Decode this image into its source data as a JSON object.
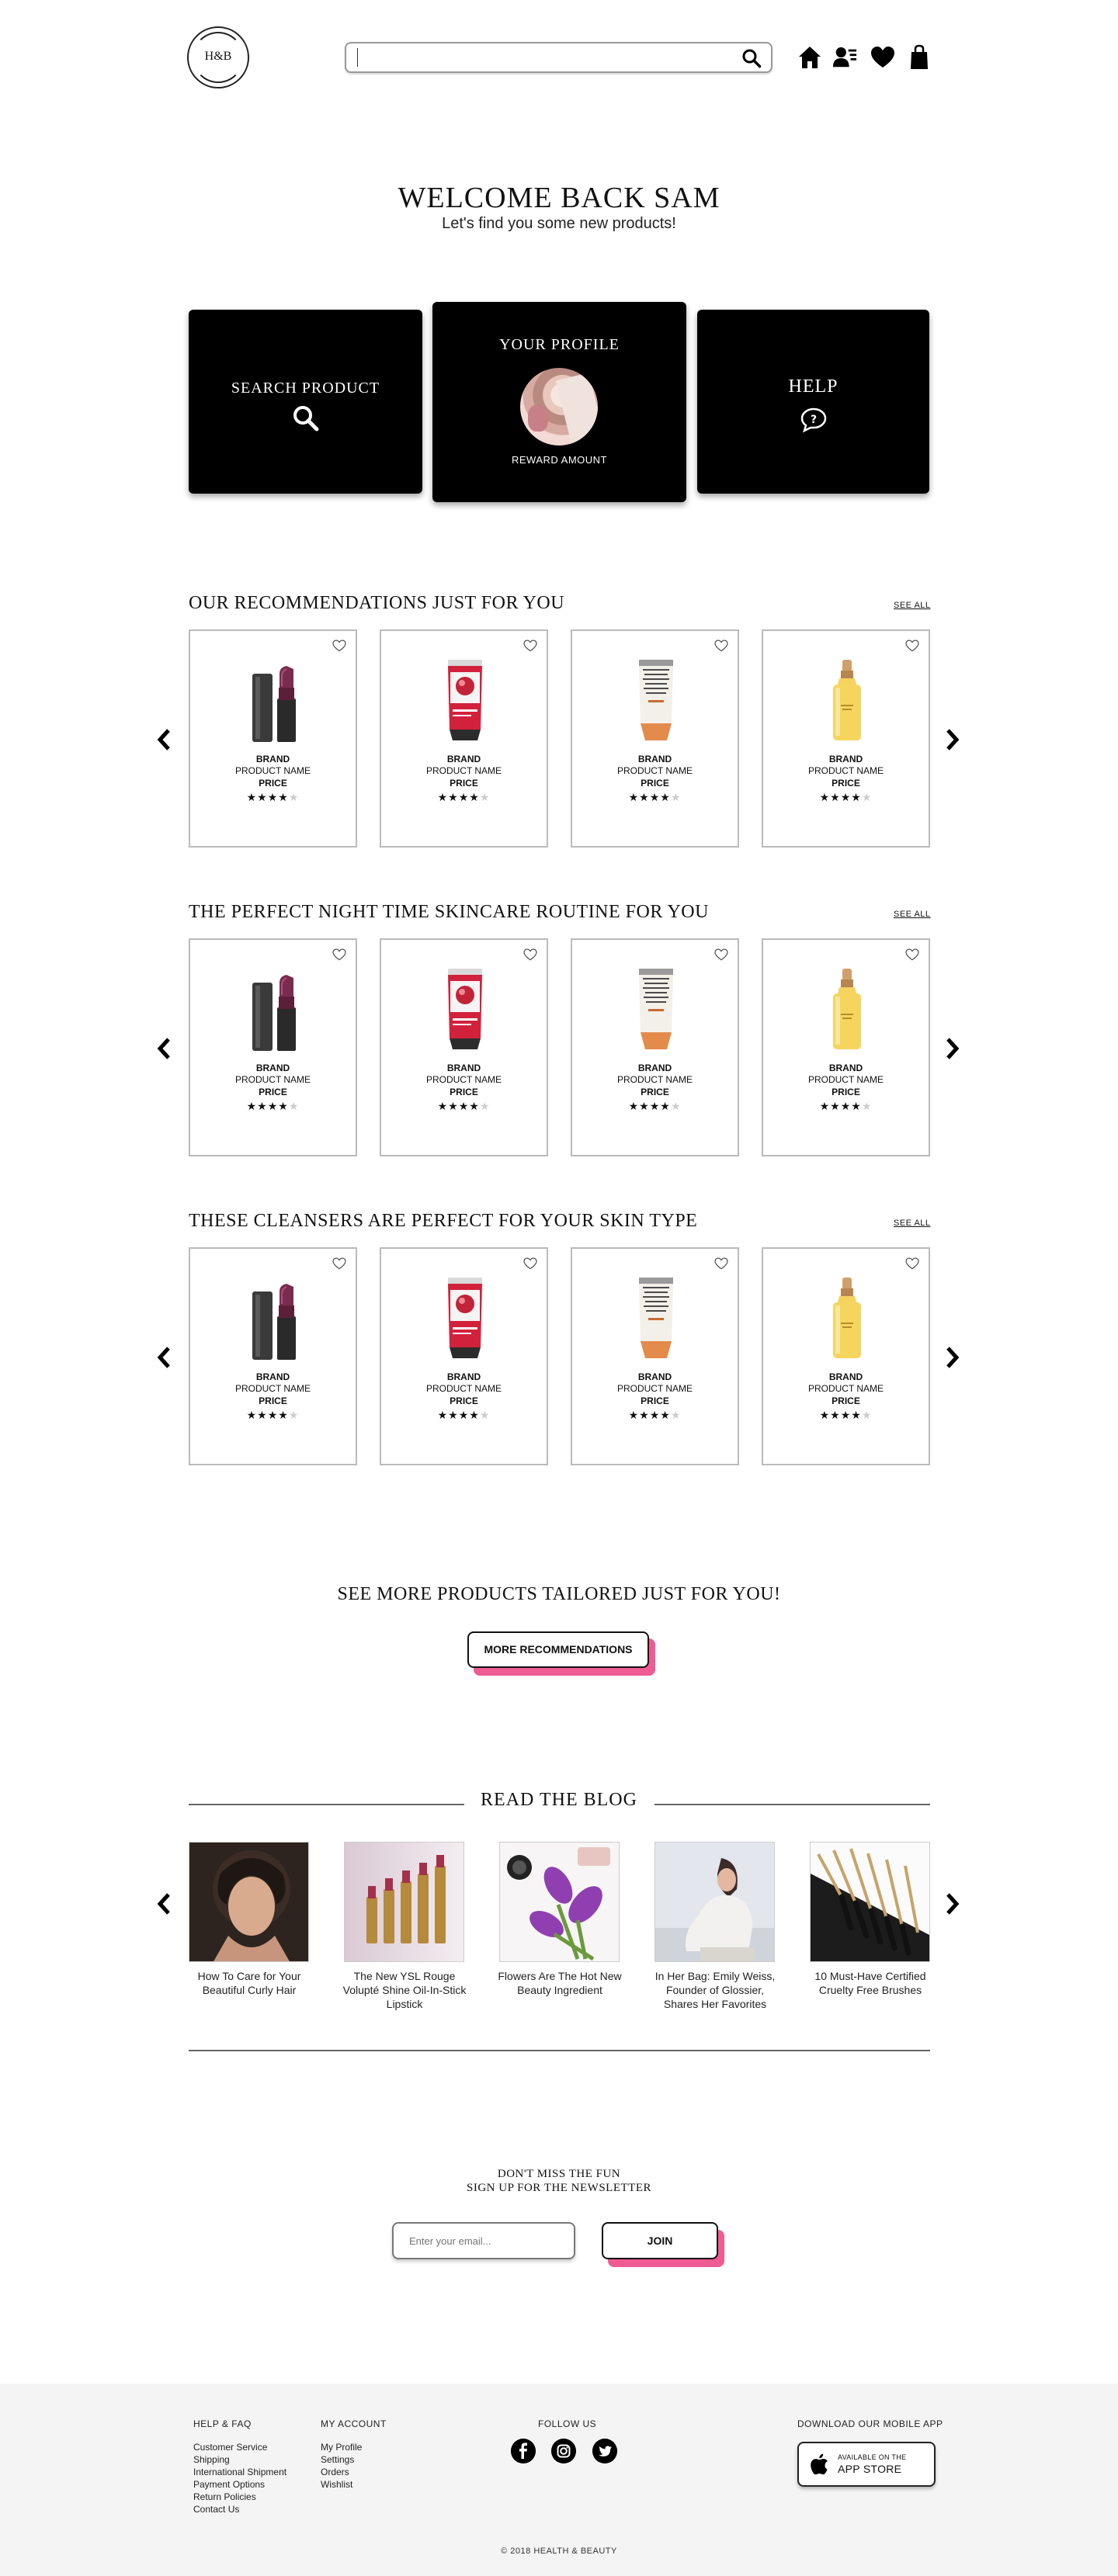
{
  "header": {
    "logo_text": "H&B",
    "search_placeholder": "",
    "icons": [
      "home-icon",
      "account-icon",
      "heart-icon",
      "bag-icon"
    ]
  },
  "welcome": {
    "title": "WELCOME BACK SAM",
    "subtitle": "Let's find you some new products!"
  },
  "cards": {
    "search_label": "SEARCH PRODUCT",
    "profile_label": "YOUR PROFILE",
    "reward_label": "REWARD AMOUNT",
    "help_label": "HELP"
  },
  "sections": [
    {
      "title": "OUR RECOMMENDATIONS JUST FOR YOU",
      "see_all": "SEE ALL",
      "products": [
        {
          "image": "lipstick",
          "brand": "BRAND",
          "name": "PRODUCT NAME",
          "price": "PRICE",
          "rating": 4
        },
        {
          "image": "red-tube",
          "brand": "BRAND",
          "name": "PRODUCT NAME",
          "price": "PRICE",
          "rating": 4
        },
        {
          "image": "cream-tube",
          "brand": "BRAND",
          "name": "PRODUCT NAME",
          "price": "PRICE",
          "rating": 4
        },
        {
          "image": "serum-bottle",
          "brand": "BRAND",
          "name": "PRODUCT NAME",
          "price": "PRICE",
          "rating": 4
        }
      ]
    },
    {
      "title": "THE PERFECT NIGHT TIME SKINCARE ROUTINE FOR YOU",
      "see_all": "SEE ALL",
      "products": [
        {
          "image": "lipstick",
          "brand": "BRAND",
          "name": "PRODUCT NAME",
          "price": "PRICE",
          "rating": 4
        },
        {
          "image": "red-tube",
          "brand": "BRAND",
          "name": "PRODUCT NAME",
          "price": "PRICE",
          "rating": 4
        },
        {
          "image": "cream-tube",
          "brand": "BRAND",
          "name": "PRODUCT NAME",
          "price": "PRICE",
          "rating": 4
        },
        {
          "image": "serum-bottle",
          "brand": "BRAND",
          "name": "PRODUCT NAME",
          "price": "PRICE",
          "rating": 4
        }
      ]
    },
    {
      "title": "THESE CLEANSERS ARE PERFECT FOR YOUR SKIN TYPE",
      "see_all": "SEE ALL",
      "products": [
        {
          "image": "lipstick",
          "brand": "BRAND",
          "name": "PRODUCT NAME",
          "price": "PRICE",
          "rating": 4
        },
        {
          "image": "red-tube",
          "brand": "BRAND",
          "name": "PRODUCT NAME",
          "price": "PRICE",
          "rating": 4
        },
        {
          "image": "cream-tube",
          "brand": "BRAND",
          "name": "PRODUCT NAME",
          "price": "PRICE",
          "rating": 4
        },
        {
          "image": "serum-bottle",
          "brand": "BRAND",
          "name": "PRODUCT NAME",
          "price": "PRICE",
          "rating": 4
        }
      ]
    }
  ],
  "more": {
    "title": "SEE MORE PRODUCTS TAILORED JUST FOR YOU!",
    "button": "MORE RECOMMENDATIONS"
  },
  "blog": {
    "title": "READ THE BLOG",
    "posts": [
      {
        "caption": "How To Care for Your Beautiful Curly Hair"
      },
      {
        "caption": "The New YSL Rouge Volupté Shine Oil-In-Stick Lipstick"
      },
      {
        "caption": "Flowers Are The Hot New Beauty Ingredient"
      },
      {
        "caption": "In Her Bag: Emily Weiss, Founder of Glossier, Shares Her Favorites"
      },
      {
        "caption": "10 Must-Have Certified Cruelty Free Brushes"
      }
    ]
  },
  "newsletter": {
    "line1": "DON'T MISS THE FUN",
    "line2": "SIGN UP FOR THE NEWSLETTER",
    "placeholder": "Enter your email...",
    "button": "JOIN"
  },
  "footer": {
    "help_heading": "HELP & FAQ",
    "help_links": [
      "Customer Service",
      "Shipping",
      "International Shipment",
      "Payment Options",
      "Return Policies",
      "Contact Us"
    ],
    "account_heading": "MY ACCOUNT",
    "account_links": [
      "My Profile",
      "Settings",
      "Orders",
      "Wishlist"
    ],
    "follow_heading": "FOLLOW US",
    "social": [
      "facebook-icon",
      "instagram-icon",
      "twitter-icon"
    ],
    "app_heading": "DOWNLOAD OUR MOBILE APP",
    "app_small": "AVAILABLE ON THE",
    "app_big": "APP STORE",
    "copyright": "© 2018 HEALTH & BEAUTY"
  },
  "colors": {
    "accent": "#ef5b93",
    "card": "#000000",
    "footer_bg": "#f4f4f4"
  }
}
